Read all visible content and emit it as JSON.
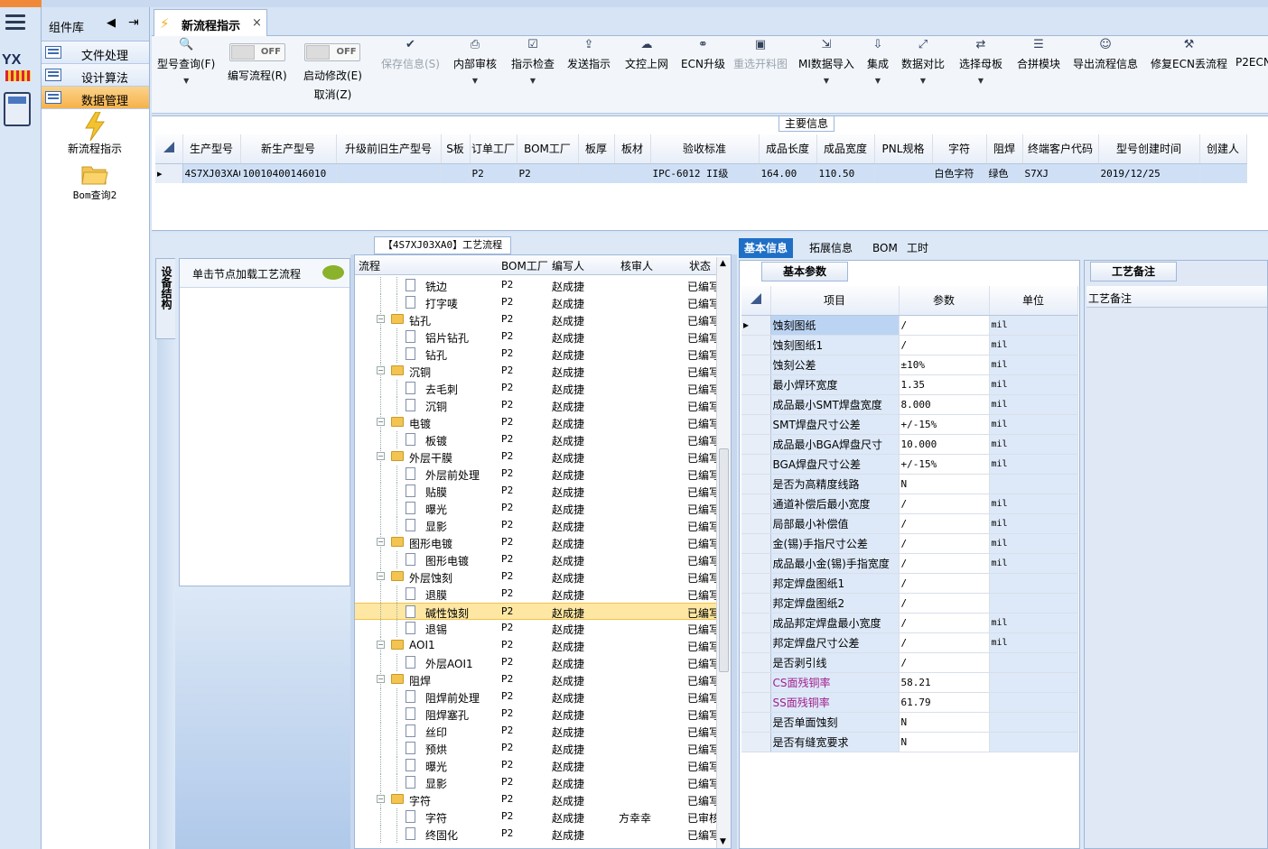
{
  "component_library": {
    "title": "组件库",
    "nav": [
      {
        "label": "文件处理",
        "active": false
      },
      {
        "label": "设计算法",
        "active": false
      },
      {
        "label": "数据管理",
        "active": true
      }
    ],
    "tiles": [
      {
        "label": "新流程指示",
        "icon": "lightning-icon"
      },
      {
        "label": "Bom查询2",
        "icon": "folder-icon"
      }
    ]
  },
  "main_tab": {
    "title": "新流程指示",
    "close": "×"
  },
  "toolbar": {
    "buttons": [
      {
        "label": "型号查询(F)",
        "icon": "search-icon",
        "dropdown": true,
        "disabled": false
      },
      {
        "label": "编写流程(R)",
        "toggle": "OFF",
        "disabled": false
      },
      {
        "label": "启动修改(E)",
        "label2": "取消(Z)",
        "toggle": "OFF",
        "disabled": false
      },
      {
        "label": "保存信息(S)",
        "icon": "check-icon",
        "disabled": true
      },
      {
        "label": "内部审核",
        "icon": "print-icon",
        "dropdown": true,
        "disabled": false
      },
      {
        "label": "指示检查",
        "icon": "checkbox-icon",
        "dropdown": true,
        "disabled": false
      },
      {
        "label": "发送指示",
        "icon": "upload-icon",
        "disabled": false
      },
      {
        "label": "文控上网",
        "icon": "cloud-upload-icon",
        "disabled": false
      },
      {
        "label": "ECN升级",
        "icon": "binoculars-icon",
        "disabled": false
      },
      {
        "label": "重选开料图",
        "icon": "image-icon",
        "disabled": true
      },
      {
        "label": "MI数据导入",
        "icon": "import-icon",
        "dropdown": true,
        "disabled": false
      },
      {
        "label": "集成",
        "icon": "download-icon",
        "dropdown": true,
        "disabled": false
      },
      {
        "label": "数据对比",
        "icon": "compare-icon",
        "dropdown": true,
        "disabled": false
      },
      {
        "label": "选择母板",
        "icon": "shuffle-icon",
        "dropdown": true,
        "disabled": false
      },
      {
        "label": "合拼模块",
        "icon": "list-icon",
        "disabled": false
      },
      {
        "label": "导出流程信息",
        "icon": "smile-icon",
        "disabled": false
      },
      {
        "label": "修复ECN丢流程",
        "icon": "wrench-icon",
        "disabled": false
      },
      {
        "label": "P2ECN",
        "icon": "",
        "disabled": false
      }
    ]
  },
  "main_info": {
    "caption": "主要信息",
    "columns": [
      "生产型号",
      "新生产型号",
      "升级前旧生产型号",
      "S板",
      "订单工厂",
      "BOM工厂",
      "板厚",
      "板材",
      "验收标准",
      "成品长度",
      "成品宽度",
      "PNL规格",
      "字符",
      "阻焊",
      "终端客户代码",
      "型号创建时间",
      "创建人"
    ],
    "rows": [
      [
        "4S7XJ03XA0",
        "10010400146010",
        "",
        "",
        "P2",
        "P2",
        "",
        "",
        "IPC-6012 II级",
        "164.00",
        "110.50",
        "",
        "白色字符",
        "绿色",
        "S7XJ",
        "2019/12/25",
        ""
      ]
    ]
  },
  "equipment": {
    "tab": "设备结构",
    "hint": "单击节点加载工艺流程"
  },
  "flow": {
    "caption": "【4S7XJ03XA0】工艺流程",
    "headers": {
      "name": "流程",
      "bom": "BOM工厂",
      "editor": "编写人",
      "reviewer": "核审人",
      "status": "状态"
    },
    "rows": [
      {
        "name": "铣边",
        "level": 2,
        "bom": "P2",
        "editor": "赵成捷",
        "reviewer": "",
        "status": "已编写"
      },
      {
        "name": "打字唛",
        "level": 2,
        "bom": "P2",
        "editor": "赵成捷",
        "reviewer": "",
        "status": "已编写"
      },
      {
        "name": "钻孔",
        "level": 1,
        "bom": "P2",
        "editor": "赵成捷",
        "reviewer": "",
        "status": "已编写"
      },
      {
        "name": "铝片钻孔",
        "level": 2,
        "bom": "P2",
        "editor": "赵成捷",
        "reviewer": "",
        "status": "已编写"
      },
      {
        "name": "钻孔",
        "level": 2,
        "bom": "P2",
        "editor": "赵成捷",
        "reviewer": "",
        "status": "已编写"
      },
      {
        "name": "沉铜",
        "level": 1,
        "bom": "P2",
        "editor": "赵成捷",
        "reviewer": "",
        "status": "已编写"
      },
      {
        "name": "去毛刺",
        "level": 2,
        "bom": "P2",
        "editor": "赵成捷",
        "reviewer": "",
        "status": "已编写"
      },
      {
        "name": "沉铜",
        "level": 2,
        "bom": "P2",
        "editor": "赵成捷",
        "reviewer": "",
        "status": "已编写"
      },
      {
        "name": "电镀",
        "level": 1,
        "bom": "P2",
        "editor": "赵成捷",
        "reviewer": "",
        "status": "已编写"
      },
      {
        "name": "板镀",
        "level": 2,
        "bom": "P2",
        "editor": "赵成捷",
        "reviewer": "",
        "status": "已编写"
      },
      {
        "name": "外层干膜",
        "level": 1,
        "bom": "P2",
        "editor": "赵成捷",
        "reviewer": "",
        "status": "已编写"
      },
      {
        "name": "外层前处理",
        "level": 2,
        "bom": "P2",
        "editor": "赵成捷",
        "reviewer": "",
        "status": "已编写"
      },
      {
        "name": "贴膜",
        "level": 2,
        "bom": "P2",
        "editor": "赵成捷",
        "reviewer": "",
        "status": "已编写"
      },
      {
        "name": "曝光",
        "level": 2,
        "bom": "P2",
        "editor": "赵成捷",
        "reviewer": "",
        "status": "已编写"
      },
      {
        "name": "显影",
        "level": 2,
        "bom": "P2",
        "editor": "赵成捷",
        "reviewer": "",
        "status": "已编写"
      },
      {
        "name": "图形电镀",
        "level": 1,
        "bom": "P2",
        "editor": "赵成捷",
        "reviewer": "",
        "status": "已编写"
      },
      {
        "name": "图形电镀",
        "level": 2,
        "bom": "P2",
        "editor": "赵成捷",
        "reviewer": "",
        "status": "已编写"
      },
      {
        "name": "外层蚀刻",
        "level": 1,
        "bom": "P2",
        "editor": "赵成捷",
        "reviewer": "",
        "status": "已编写"
      },
      {
        "name": "退膜",
        "level": 2,
        "bom": "P2",
        "editor": "赵成捷",
        "reviewer": "",
        "status": "已编写"
      },
      {
        "name": "碱性蚀刻",
        "level": 2,
        "bom": "P2",
        "editor": "赵成捷",
        "reviewer": "",
        "status": "已编写",
        "selected": true
      },
      {
        "name": "退锡",
        "level": 2,
        "bom": "P2",
        "editor": "赵成捷",
        "reviewer": "",
        "status": "已编写"
      },
      {
        "name": "AOI1",
        "level": 1,
        "bom": "P2",
        "editor": "赵成捷",
        "reviewer": "",
        "status": "已编写"
      },
      {
        "name": "外层AOI1",
        "level": 2,
        "bom": "P2",
        "editor": "赵成捷",
        "reviewer": "",
        "status": "已编写"
      },
      {
        "name": "阻焊",
        "level": 1,
        "bom": "P2",
        "editor": "赵成捷",
        "reviewer": "",
        "status": "已编写"
      },
      {
        "name": "阻焊前处理",
        "level": 2,
        "bom": "P2",
        "editor": "赵成捷",
        "reviewer": "",
        "status": "已编写"
      },
      {
        "name": "阻焊塞孔",
        "level": 2,
        "bom": "P2",
        "editor": "赵成捷",
        "reviewer": "",
        "status": "已编写"
      },
      {
        "name": "丝印",
        "level": 2,
        "bom": "P2",
        "editor": "赵成捷",
        "reviewer": "",
        "status": "已编写"
      },
      {
        "name": "预烘",
        "level": 2,
        "bom": "P2",
        "editor": "赵成捷",
        "reviewer": "",
        "status": "已编写"
      },
      {
        "name": "曝光",
        "level": 2,
        "bom": "P2",
        "editor": "赵成捷",
        "reviewer": "",
        "status": "已编写"
      },
      {
        "name": "显影",
        "level": 2,
        "bom": "P2",
        "editor": "赵成捷",
        "reviewer": "",
        "status": "已编写"
      },
      {
        "name": "字符",
        "level": 1,
        "bom": "P2",
        "editor": "赵成捷",
        "reviewer": "",
        "status": "已编写"
      },
      {
        "name": "字符",
        "level": 2,
        "bom": "P2",
        "editor": "赵成捷",
        "reviewer": "方幸幸",
        "status": "已审核"
      },
      {
        "name": "终固化",
        "level": 2,
        "bom": "P2",
        "editor": "赵成捷",
        "reviewer": "",
        "status": "已编写"
      }
    ]
  },
  "right_tabs": [
    {
      "label": "基本信息",
      "active": true
    },
    {
      "label": "拓展信息",
      "active": false
    },
    {
      "label": "BOM",
      "active": false
    },
    {
      "label": "工时",
      "active": false
    }
  ],
  "basic_params": {
    "caption": "基本参数",
    "headers": [
      "项目",
      "参数",
      "单位"
    ],
    "rows": [
      {
        "item": "蚀刻图纸",
        "value": "/",
        "unit": "mil",
        "current": true
      },
      {
        "item": "蚀刻图纸1",
        "value": "/",
        "unit": "mil"
      },
      {
        "item": "蚀刻公差",
        "value": "±10%",
        "unit": "mil"
      },
      {
        "item": "最小焊环宽度",
        "value": "1.35",
        "unit": "mil"
      },
      {
        "item": "成品最小SMT焊盘宽度",
        "value": "8.000",
        "unit": "mil"
      },
      {
        "item": "SMT焊盘尺寸公差",
        "value": "+/-15%",
        "unit": "mil"
      },
      {
        "item": "成品最小BGA焊盘尺寸",
        "value": "10.000",
        "unit": "mil"
      },
      {
        "item": "BGA焊盘尺寸公差",
        "value": "+/-15%",
        "unit": "mil"
      },
      {
        "item": "是否为高精度线路",
        "value": "N",
        "unit": ""
      },
      {
        "item": "通道补偿后最小宽度",
        "value": "/",
        "unit": "mil"
      },
      {
        "item": "局部最小补偿值",
        "value": "/",
        "unit": "mil"
      },
      {
        "item": "金(锡)手指尺寸公差",
        "value": "/",
        "unit": "mil"
      },
      {
        "item": "成品最小金(锡)手指宽度",
        "value": "/",
        "unit": "mil"
      },
      {
        "item": "邦定焊盘图纸1",
        "value": "/",
        "unit": ""
      },
      {
        "item": "邦定焊盘图纸2",
        "value": "/",
        "unit": ""
      },
      {
        "item": "成品邦定焊盘最小宽度",
        "value": "/",
        "unit": "mil"
      },
      {
        "item": "邦定焊盘尺寸公差",
        "value": "/",
        "unit": "mil"
      },
      {
        "item": "是否剥引线",
        "value": "/",
        "unit": ""
      },
      {
        "item": "CS面残铜率",
        "value": "58.21",
        "unit": "",
        "purple": true
      },
      {
        "item": "SS面残铜率",
        "value": "61.79",
        "unit": "",
        "purple": true
      },
      {
        "item": "是否单面蚀刻",
        "value": "N",
        "unit": ""
      },
      {
        "item": "是否有缝宽要求",
        "value": "N",
        "unit": ""
      }
    ]
  },
  "craft_notes": {
    "caption": "工艺备注",
    "column": "工艺备注"
  },
  "colors": {
    "accent": "#1f6fc6",
    "selection": "#fde7a2",
    "nav_active": "#f6b24a",
    "purple_text": "#a1208d"
  }
}
